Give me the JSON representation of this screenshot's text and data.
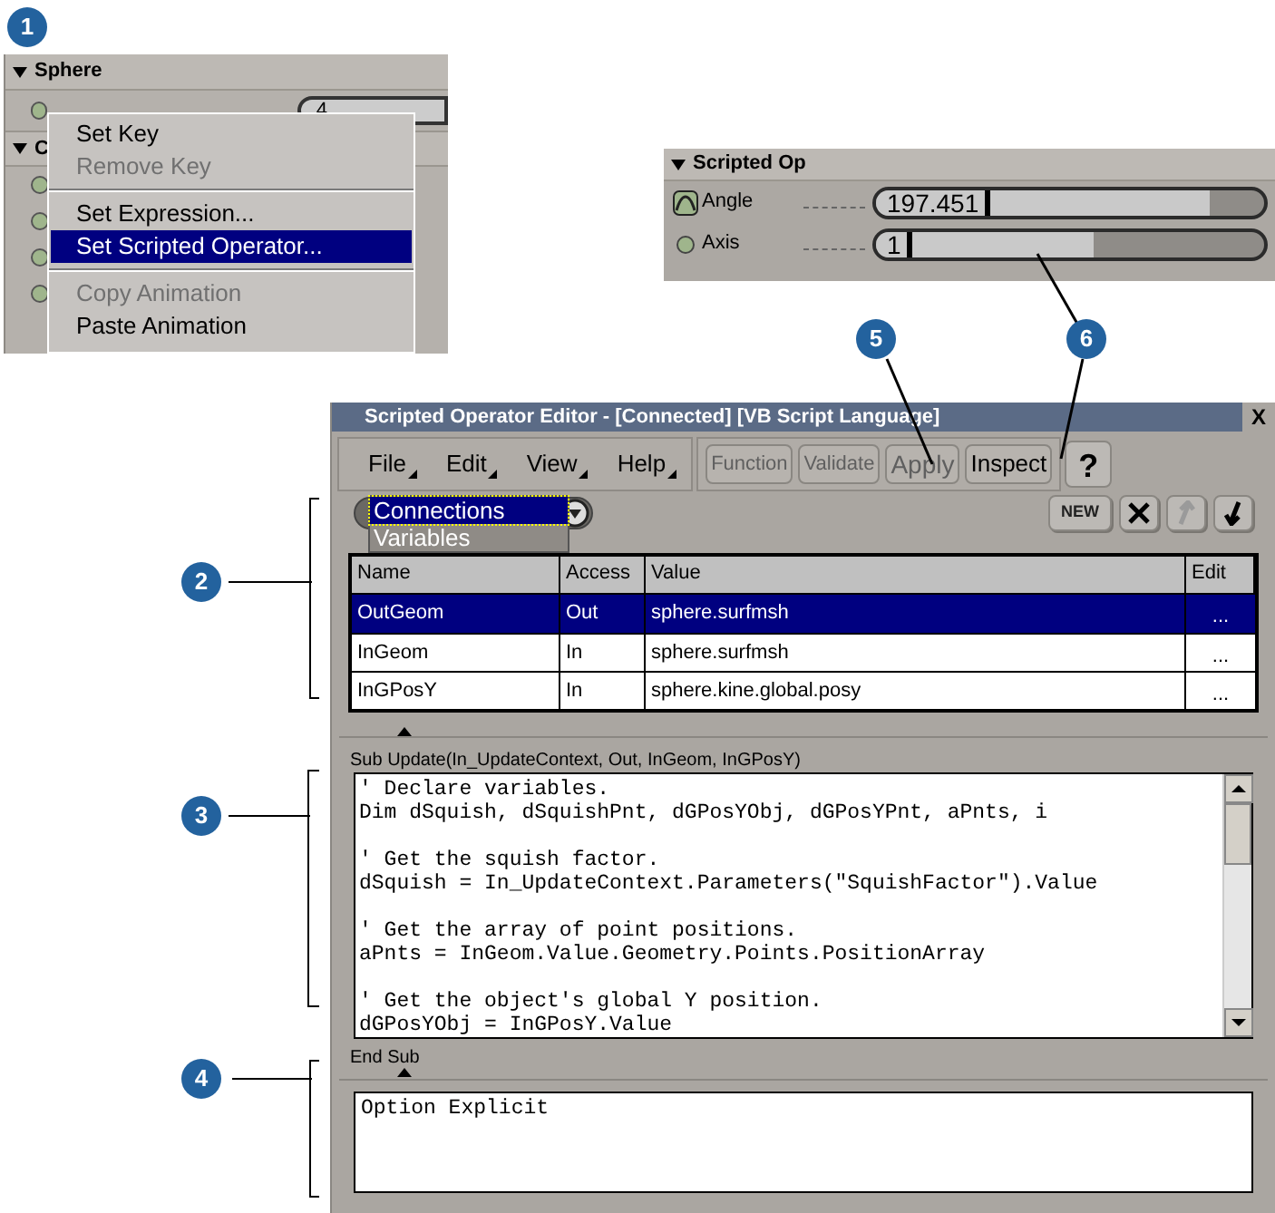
{
  "callouts": [
    {
      "label": "1"
    },
    {
      "label": "2"
    },
    {
      "label": "3"
    },
    {
      "label": "4"
    },
    {
      "label": "5"
    },
    {
      "label": "6"
    }
  ],
  "sphere_panel": {
    "sections": [
      {
        "title": "Sphere",
        "expanded": true
      },
      {
        "title": "C",
        "expanded": true
      }
    ],
    "field_value": "4"
  },
  "context_menu": {
    "items": [
      {
        "kind": "item",
        "label": "Set Key",
        "disabled": false,
        "selected": false
      },
      {
        "kind": "item",
        "label": "Remove Key",
        "disabled": true,
        "selected": false
      },
      {
        "kind": "separator"
      },
      {
        "kind": "item",
        "label": "Set Expression...",
        "disabled": false,
        "selected": false
      },
      {
        "kind": "item",
        "label": "Set Scripted Operator...",
        "disabled": false,
        "selected": true
      },
      {
        "kind": "separator"
      },
      {
        "kind": "item",
        "label": "Copy Animation",
        "disabled": true,
        "selected": false
      },
      {
        "kind": "item",
        "label": "Paste Animation",
        "disabled": false,
        "selected": false
      }
    ]
  },
  "scripted_op_panel": {
    "title": "Scripted Op",
    "params": [
      {
        "label": "Angle",
        "value": "197.451",
        "animated": true,
        "level": 0.86
      },
      {
        "label": "Axis",
        "value": "1",
        "animated": false,
        "level": 0.56
      }
    ]
  },
  "editor": {
    "title": "Scripted Operator Editor - [Connected] [VB Script Language]",
    "close": "X",
    "menus": [
      "File",
      "Edit",
      "View",
      "Help"
    ],
    "buttons": [
      {
        "label": "Function",
        "disabled": true
      },
      {
        "label": "Validate",
        "disabled": true
      },
      {
        "label": "Apply",
        "disabled": true
      },
      {
        "label": "Inspect",
        "disabled": false
      },
      {
        "label": "?",
        "disabled": false
      }
    ],
    "dropdown": {
      "expanded": true,
      "options": [
        {
          "label": "Connections",
          "selected": true
        },
        {
          "label": "Variables",
          "selected": false
        }
      ]
    },
    "toolbar": [
      {
        "kind": "new",
        "label": "NEW",
        "disabled": false
      },
      {
        "kind": "delete",
        "disabled": false
      },
      {
        "kind": "up",
        "disabled": true
      },
      {
        "kind": "down",
        "disabled": false
      }
    ],
    "table": {
      "columns": [
        "Name",
        "Access",
        "Value",
        "Edit"
      ],
      "rows": [
        {
          "name": "OutGeom",
          "access": "Out",
          "value": "sphere.surfmsh",
          "edit": "...",
          "selected": true
        },
        {
          "name": "InGeom",
          "access": "In",
          "value": "sphere.surfmsh",
          "edit": "...",
          "selected": false
        },
        {
          "name": "InGPosY",
          "access": "In",
          "value": "sphere.kine.global.posy",
          "edit": "...",
          "selected": false
        }
      ]
    },
    "sub_header": "Sub Update(In_UpdateContext, Out, InGeom, InGPosY)",
    "code_blocks": [
      [
        "' Declare variables.",
        "Dim dSquish, dSquishPnt, dGPosYObj, dGPosYPnt, aPnts, i"
      ],
      [
        "' Get the squish factor.",
        "dSquish = In_UpdateContext.Parameters(\"SquishFactor\").Value"
      ],
      [
        "' Get the array of point positions.",
        "aPnts = InGeom.Value.Geometry.Points.PositionArray"
      ],
      [
        "' Get the object's global Y position.",
        "dGPosYObj = InGPosY.Value"
      ]
    ],
    "sub_footer": "End Sub",
    "global_code_lines": [
      "Option Explicit"
    ]
  }
}
